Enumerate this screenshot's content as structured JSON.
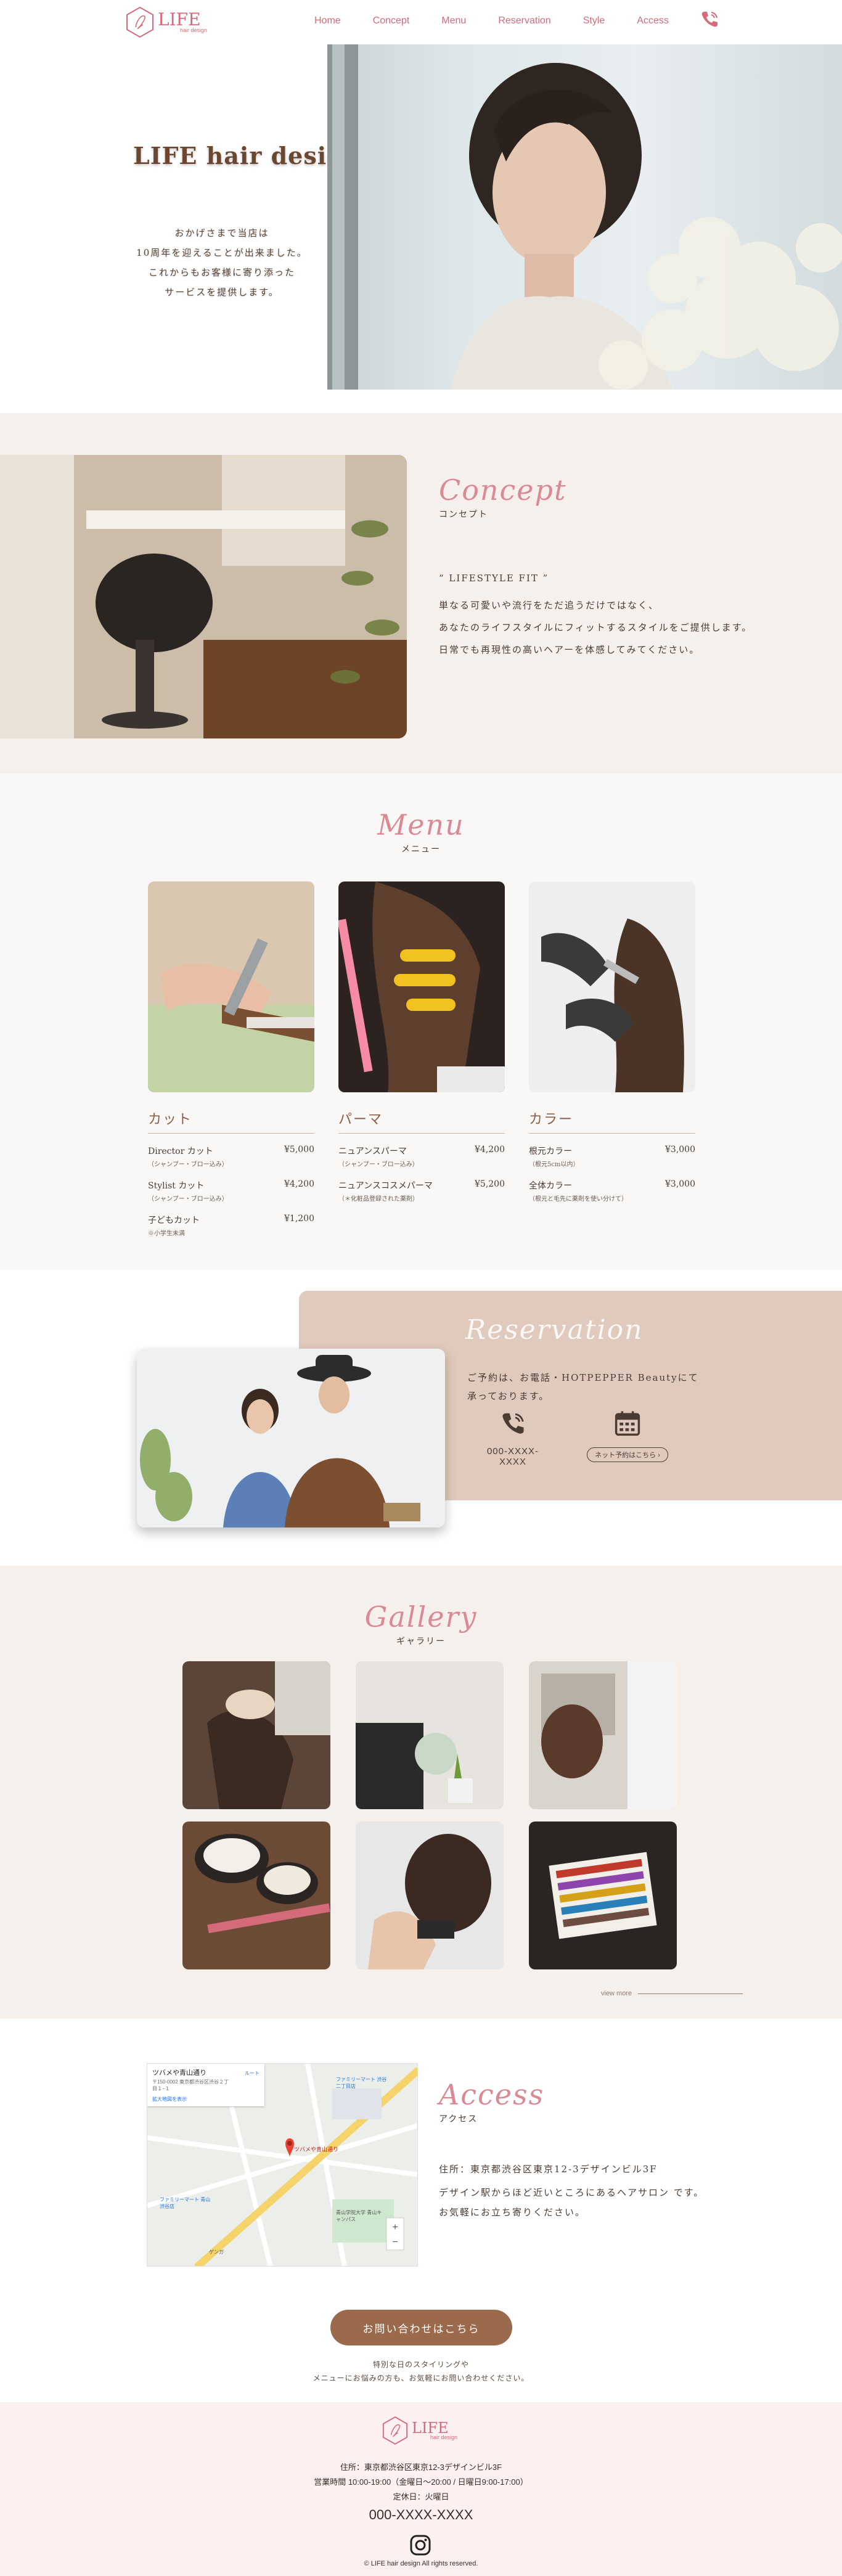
{
  "header": {
    "logo_text": "LIFE",
    "logo_sub": "hair design",
    "nav": [
      "Home",
      "Concept",
      "Menu",
      "Reservation",
      "Style",
      "Access"
    ]
  },
  "hero": {
    "title": "LIFE hair design",
    "text": [
      "おかげさまで当店は",
      "10周年を迎えることが出来ました。",
      "これからもお客様に寄り添った",
      "サービスを提供します。"
    ]
  },
  "concept": {
    "script": "Concept",
    "jp": "コンセプト",
    "body": [
      "“ LIFESTYLE FIT ”",
      "単なる可愛いや流行をただ追うだけではなく、",
      "あなたのライフスタイルにフィットするスタイルをご提供します。",
      "日常でも再現性の高いヘアーを体感してみてください。"
    ]
  },
  "menu": {
    "script": "Menu",
    "jp": "メニュー",
    "columns": [
      {
        "title": "カット",
        "items": [
          {
            "name": "Director カット",
            "price": "¥5,000",
            "note": "（シャンプー・ブロー込み）"
          },
          {
            "name": "Stylist カット",
            "price": "¥4,200",
            "note": "（シャンプー・ブロー込み）"
          },
          {
            "name": "子どもカット",
            "price": "¥1,200",
            "note": "※小学生未満"
          }
        ]
      },
      {
        "title": "パーマ",
        "items": [
          {
            "name": "ニュアンスパーマ",
            "price": "¥4,200",
            "note": "（シャンプー・ブロー込み）"
          },
          {
            "name": "ニュアンスコスメパーマ",
            "price": "¥5,200",
            "note": "（＊化粧品登録された薬剤）"
          }
        ]
      },
      {
        "title": "カラー",
        "items": [
          {
            "name": "根元カラー",
            "price": "¥3,000",
            "note": "（根元5cm以内）"
          },
          {
            "name": "全体カラー",
            "price": "¥3,000",
            "note": "（根元と毛先に薬剤を使い分けて）"
          }
        ]
      }
    ]
  },
  "reservation": {
    "script": "Reservation",
    "text": [
      "ご予約は、お電話・HOTPEPPER Beautyにて",
      "承っております。"
    ],
    "phone": "000-XXXX-XXXX",
    "net_button": "ネット予約はこちら ›"
  },
  "gallery": {
    "script": "Gallery",
    "jp": "ギャラリー",
    "view_more": "view more"
  },
  "access": {
    "script": "Access",
    "jp": "アクセス",
    "body": [
      "住所：東京都渋谷区東京12-3デザインビル3F",
      "デザイン駅からほど近いところにあるヘアサロン です。",
      "お気軽にお立ち寄りください。"
    ],
    "map": {
      "place": "ツバメや青山通り",
      "address": "〒150-0002 東京都渋谷区渋谷２丁目１−１",
      "route": "ルート",
      "enlarge": "拡大地図を表示",
      "labels": [
        "ファミリーマート 渋谷二丁目店",
        "青山学院大学 青山キャンパス",
        "ファミリーマート 青山渋谷店",
        "ゲンガ"
      ]
    },
    "contact_button": "お問い合わせはこちら",
    "contact_note": [
      "特別な日のスタイリングや",
      "メニューにお悩みの方も、お気軽にお問い合わせください。"
    ]
  },
  "footer": {
    "logo_text": "LIFE",
    "logo_sub": "hair design",
    "info": [
      "住所：東京都渋谷区東京12-3デザインビル3F",
      "営業時間 10:00-19:00（金曜日〜20:00 / 日曜日9:00-17:00）",
      "定休日：火曜日"
    ],
    "tel": "000-XXXX-XXXX",
    "copy": "© LIFE hair design All rights reserved."
  }
}
